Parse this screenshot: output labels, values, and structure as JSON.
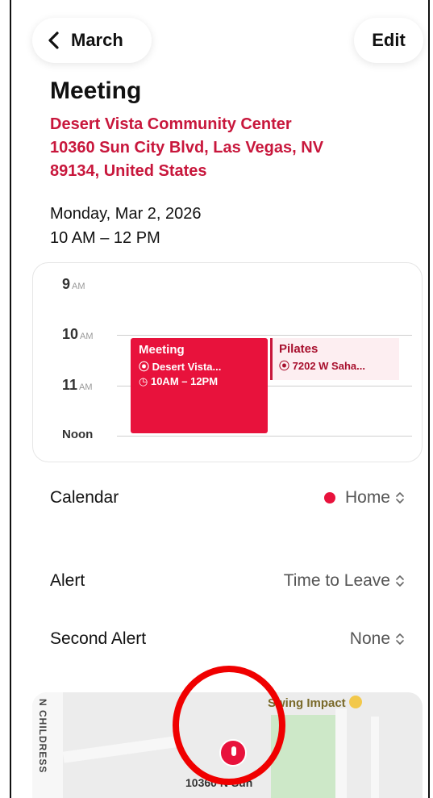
{
  "header": {
    "back_label": "March",
    "edit_label": "Edit"
  },
  "event": {
    "title": "Meeting",
    "location_lines": [
      "Desert Vista Community Center",
      "10360 Sun City Blvd, Las Vegas, NV",
      "89134, United States"
    ],
    "date": "Monday, Mar 2, 2026",
    "time": "10 AM – 12 PM"
  },
  "day_preview": {
    "hours": [
      {
        "num": "9",
        "ampm": "AM"
      },
      {
        "num": "10",
        "ampm": "AM"
      },
      {
        "num": "11",
        "ampm": "AM"
      },
      {
        "num": "Noon",
        "ampm": ""
      }
    ],
    "events": [
      {
        "title": "Meeting",
        "location": "Desert Vista...",
        "time": "10AM – 12PM"
      },
      {
        "title": "Pilates",
        "location": "7202 W Saha..."
      }
    ]
  },
  "settings": {
    "calendar": {
      "label": "Calendar",
      "value": "Home",
      "color": "#e8123c"
    },
    "alert": {
      "label": "Alert",
      "value": "Time to Leave"
    },
    "second_alert": {
      "label": "Second Alert",
      "value": "None"
    }
  },
  "map": {
    "street": "N CHILDRESS",
    "poi": "Swing Impact",
    "address": "10360 N Sun"
  },
  "colors": {
    "accent": "#e8123c",
    "location_text": "#c8173c",
    "annotation": "#f00000"
  }
}
